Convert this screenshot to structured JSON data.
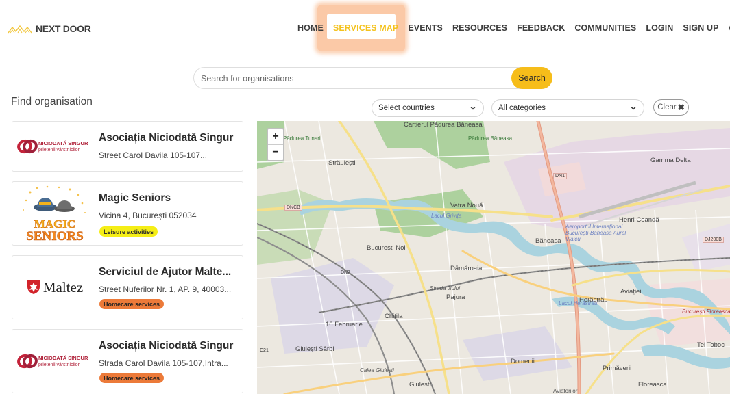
{
  "header": {
    "logo_text": "NEXT DOOR",
    "nav": [
      {
        "label": "HOME",
        "active": false
      },
      {
        "label": "SERVICES MAP",
        "active": true
      },
      {
        "label": "EVENTS",
        "active": false
      },
      {
        "label": "RESOURCES",
        "active": false
      },
      {
        "label": "FEEDBACK",
        "active": false
      },
      {
        "label": "COMMUNITIES",
        "active": false
      },
      {
        "label": "LOGIN",
        "active": false
      },
      {
        "label": "SIGN UP",
        "active": false
      }
    ],
    "language": "EN",
    "accent_color": "#f4c21d"
  },
  "search": {
    "placeholder": "Search for organisations",
    "button_label": "Search",
    "button_color": "#f6bd1a"
  },
  "sidebar": {
    "title": "Find organisation",
    "cards": [
      {
        "name": "Asociația Niciodată Singur",
        "address": "Street Carol Davila 105-107...",
        "tag": "",
        "logo": "niciodata-singur-logo",
        "logo_text": "NICIODATĂ SINGUR",
        "logo_subtext": "prietenii vârstnicilor"
      },
      {
        "name": "Magic Seniors",
        "address": "Vicina 4, București 052034",
        "tag": "Leisure activities",
        "tag_color": "#f5ee16",
        "logo": "magic-seniors-logo",
        "logo_text": "MAGIC SENIORS"
      },
      {
        "name": "Serviciul de Ajutor Malte...",
        "address": "Street Nuferilor Nr. 1, AP. 9, 40003...",
        "tag": "Homecare services",
        "tag_color": "#ec7a39",
        "logo": "maltez-logo",
        "logo_text": "Maltez"
      },
      {
        "name": "Asociația Niciodată Singur",
        "address": "Strada Carol Davila 105-107,Intra...",
        "tag": "Homecare services",
        "tag_color": "#ec7a39",
        "logo": "niciodata-singur-logo",
        "logo_text": "NICIODATĂ SINGUR",
        "logo_subtext": "prietenii vârstnicilor"
      }
    ]
  },
  "filters": {
    "countries": "Select countries",
    "categories": "All categories",
    "clear": "Clear"
  },
  "map": {
    "zoom_in": "+",
    "zoom_out": "−",
    "labels": [
      "Cartierul Pădurea Băneasa",
      "Pădurea Băneasa",
      "Pădurea Tunari",
      "Străulești",
      "Gamma Delta",
      "Vatra Nouă",
      "Lacul Grivița",
      "Henri Coandă",
      "Aeroportul Internațional București-Băneasa Aurel Vlaicu",
      "Băneasa",
      "București Noi",
      "Dămăroaia",
      "Pajura",
      "Herăstrău",
      "Aviației",
      "Lacul Herăstrău",
      "Chitila",
      "16 Februarie",
      "Giulești Sârbi",
      "Domenii",
      "Primăverii",
      "Tei Toboc",
      "Floreasca",
      "Aviatorilor",
      "Giulești",
      "Strada Jiului",
      "Calea Giulești",
      "București Floreasca"
    ],
    "shields": [
      "DN1",
      "DNCB",
      "DJ200B",
      "DN7",
      "C21"
    ]
  }
}
